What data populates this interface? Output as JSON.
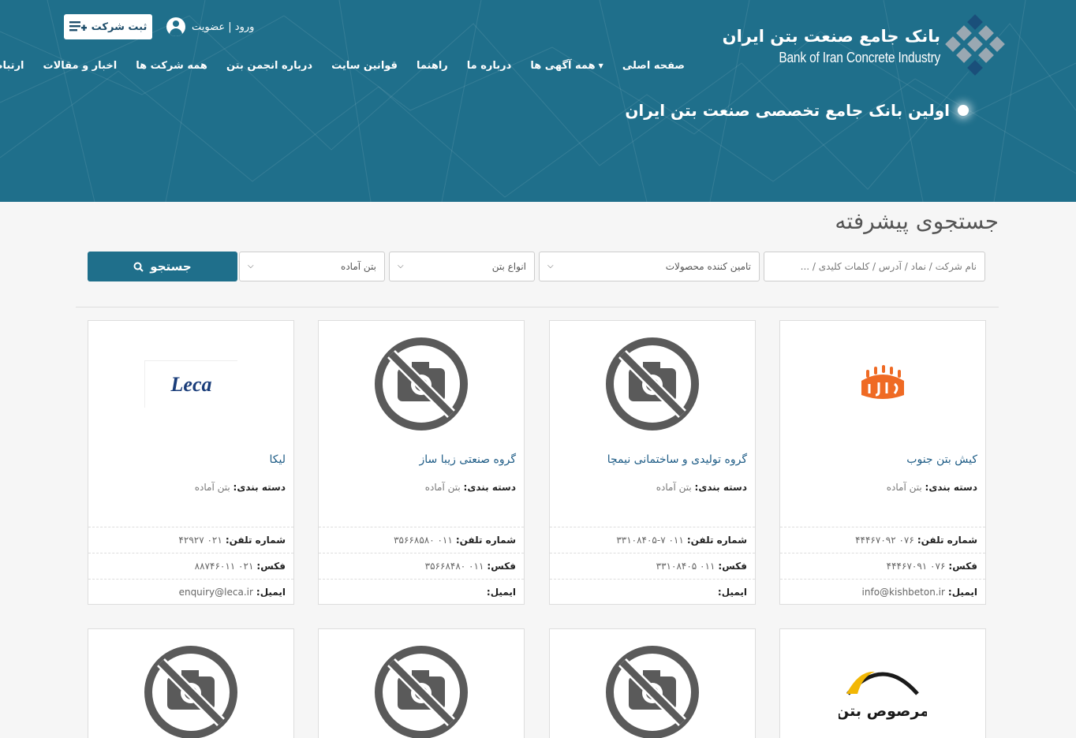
{
  "header": {
    "logo_fa": "بانک جامع صنعت بتن ایران",
    "logo_en": "Bank of Iran Concrete Industry",
    "register_button": "ثبت شرکت",
    "login_link": "ورود | عضویت",
    "tagline": "اولین بانک جامع تخصصی صنعت بتن ایران",
    "nav": [
      {
        "label": "صفحه اصلی"
      },
      {
        "label": "همه آگهی ها",
        "dropdown": true
      },
      {
        "label": "درباره ما"
      },
      {
        "label": "راهنما"
      },
      {
        "label": "قوانین سایت"
      },
      {
        "label": "درباره انجمن بتن"
      },
      {
        "label": "همه شرکت ها"
      },
      {
        "label": "اخبار و مقالات"
      },
      {
        "label": "ارتباط با ما"
      }
    ]
  },
  "page_title": "جستجوی پیشرفته",
  "search": {
    "keyword_placeholder": "نام شرکت / نماد / آدرس / کلمات کلیدی / ...",
    "supplier_select": "تامین کننده محصولات",
    "concrete_types_select": "انواع بتن",
    "readymix_select": "بتن آماده",
    "button": "جستجو"
  },
  "labels": {
    "category": "دسته بندی:",
    "phone": "شماره تلفن:",
    "fax": "فکس:",
    "email": "ایمیل:"
  },
  "companies": [
    {
      "name": "کیش بتن جنوب",
      "category": "بتن آماده",
      "phone": "۰۷۶ ۴۴۴۶۷۰۹۲",
      "fax": "۰۷۶ ۴۴۴۶۷۰۹۱",
      "email": "info@kishbeton.ir",
      "logo": "kish-logo"
    },
    {
      "name": "گروه تولیدی و ساختمانی نیمچا",
      "category": "بتن آماده",
      "phone": "۰۱۱ ۳۳۱۰۸۴۰۵-۷",
      "fax": "۰۱۱ ۳۳۱۰۸۴۰۵",
      "email": "",
      "logo": "no-image-icon"
    },
    {
      "name": "گروه صنعتی زیبا ساز",
      "category": "بتن آماده",
      "phone": "۰۱۱ ۳۵۶۶۸۵۸۰",
      "fax": "۰۱۱ ۳۵۶۶۸۴۸۰",
      "email": "",
      "logo": "no-image-icon"
    },
    {
      "name": "لیکا",
      "category": "بتن آماده",
      "phone": "۰۲۱ ۴۲۹۲۷",
      "fax": "۰۲۱ ۸۸۷۴۶۰۱۱",
      "email": "enquiry@leca.ir",
      "logo": "leca-logo",
      "logo_text": "Leca"
    },
    {
      "logo": "marsous-logo",
      "logo_text": "مرصوص بتن"
    },
    {
      "logo": "no-image-icon"
    },
    {
      "logo": "no-image-icon"
    },
    {
      "logo": "no-image-icon"
    }
  ],
  "colors": {
    "brand": "#1f6f8b",
    "link": "#1e5c86",
    "kish_orange": "#ef6a24",
    "marsous_yellow": "#f2b705"
  }
}
